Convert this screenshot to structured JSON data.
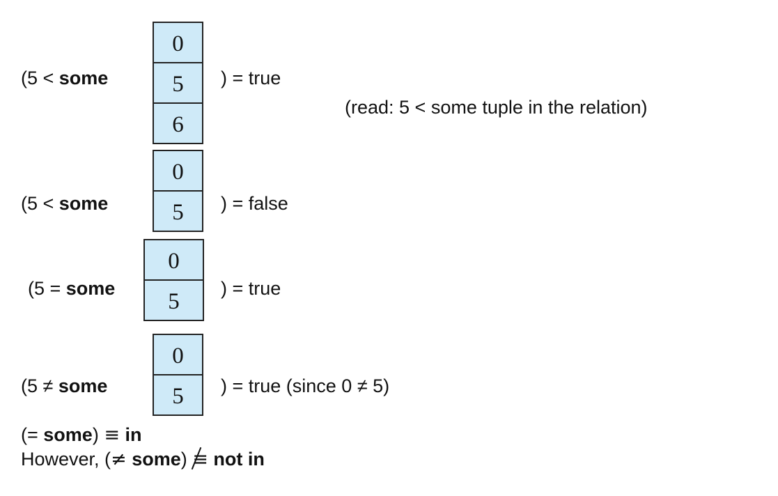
{
  "examples": [
    {
      "open": "(5 < ",
      "keyword": "some",
      "relation": [
        "0",
        "5",
        "6"
      ],
      "result": ") = true",
      "note": "(read:  5 < some tuple in the relation)"
    },
    {
      "open": "(5 < ",
      "keyword": "some",
      "relation": [
        "0",
        "5"
      ],
      "result": ") = false"
    },
    {
      "open": "(5 = ",
      "keyword": "some",
      "relation": [
        "0",
        "5"
      ],
      "result": ") = true"
    },
    {
      "open": "(5 ≠ ",
      "keyword": "some",
      "relation": [
        "0",
        "5"
      ],
      "result": ") = true (since 0 ≠ 5)"
    }
  ],
  "equivalence": {
    "open": "(= ",
    "keyword": "some",
    "close": ")",
    "symbol": "≡",
    "target": "in"
  },
  "however": {
    "prefix": "However, (",
    "neq": "≠",
    "keyword": "some",
    "close": ")",
    "symbol": "≡",
    "target": "not in"
  }
}
